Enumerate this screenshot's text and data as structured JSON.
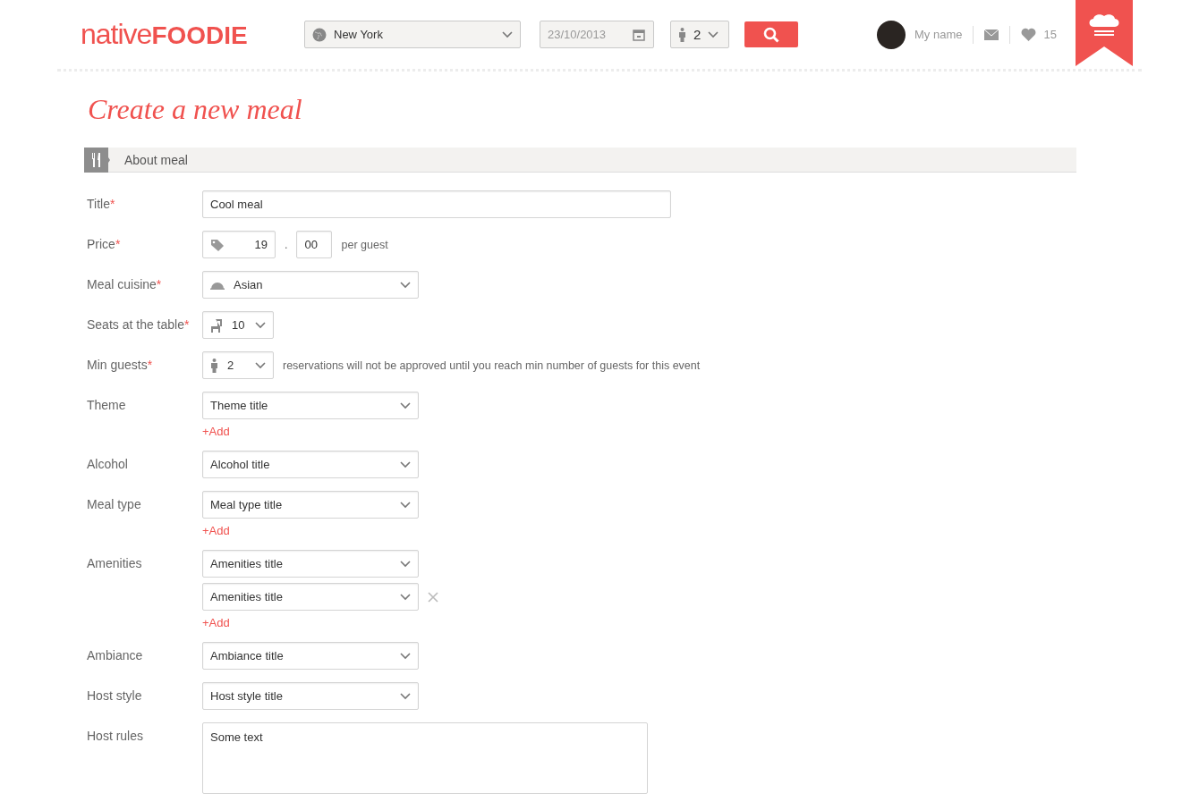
{
  "header": {
    "logo": {
      "light": "native",
      "bold": "FOODIE"
    },
    "city": {
      "value": "New York"
    },
    "date": {
      "placeholder": "23/10/2013"
    },
    "guests": {
      "value": "2"
    },
    "user": {
      "name": "My name",
      "likes": "15"
    }
  },
  "page_title": "Create a new meal",
  "section": {
    "title": "About meal"
  },
  "fields": [
    {
      "label": "Title",
      "required_mark": "*",
      "kind": "text",
      "value": "Cool meal"
    },
    {
      "label": "Price",
      "required_mark": "*",
      "kind": "price",
      "whole": "19",
      "separator": ".",
      "cents": "00",
      "suffix": "per guest"
    },
    {
      "label": "Meal cuisine",
      "required_mark": "*",
      "kind": "cuisine",
      "value": "Asian"
    },
    {
      "label": "Seats at the table",
      "required_mark": "*",
      "kind": "seats",
      "value": "10"
    },
    {
      "label": "Min guests",
      "required_mark": "*",
      "kind": "guests",
      "value": "2",
      "note": "reservations will not be approved until you reach min number of guests for this event"
    },
    {
      "label": "Theme",
      "kind": "select",
      "selects": [
        {
          "value": "Theme title",
          "removable": false
        }
      ],
      "add_link": "+Add"
    },
    {
      "label": "Alcohol",
      "kind": "select",
      "selects": [
        {
          "value": "Alcohol title",
          "removable": false
        }
      ]
    },
    {
      "label": "Meal type",
      "kind": "select",
      "selects": [
        {
          "value": "Meal type title",
          "removable": false
        }
      ],
      "add_link": "+Add"
    },
    {
      "label": "Amenities",
      "kind": "select",
      "selects": [
        {
          "value": "Amenities title",
          "removable": false
        },
        {
          "value": "Amenities title",
          "removable": true
        }
      ],
      "add_link": "+Add"
    },
    {
      "label": "Ambiance",
      "kind": "select",
      "selects": [
        {
          "value": "Ambiance title",
          "removable": false
        }
      ]
    },
    {
      "label": "Host style",
      "kind": "select",
      "selects": [
        {
          "value": "Host style title",
          "removable": false
        }
      ]
    },
    {
      "label": "Host rules",
      "kind": "textarea",
      "value": "Some text"
    }
  ]
}
